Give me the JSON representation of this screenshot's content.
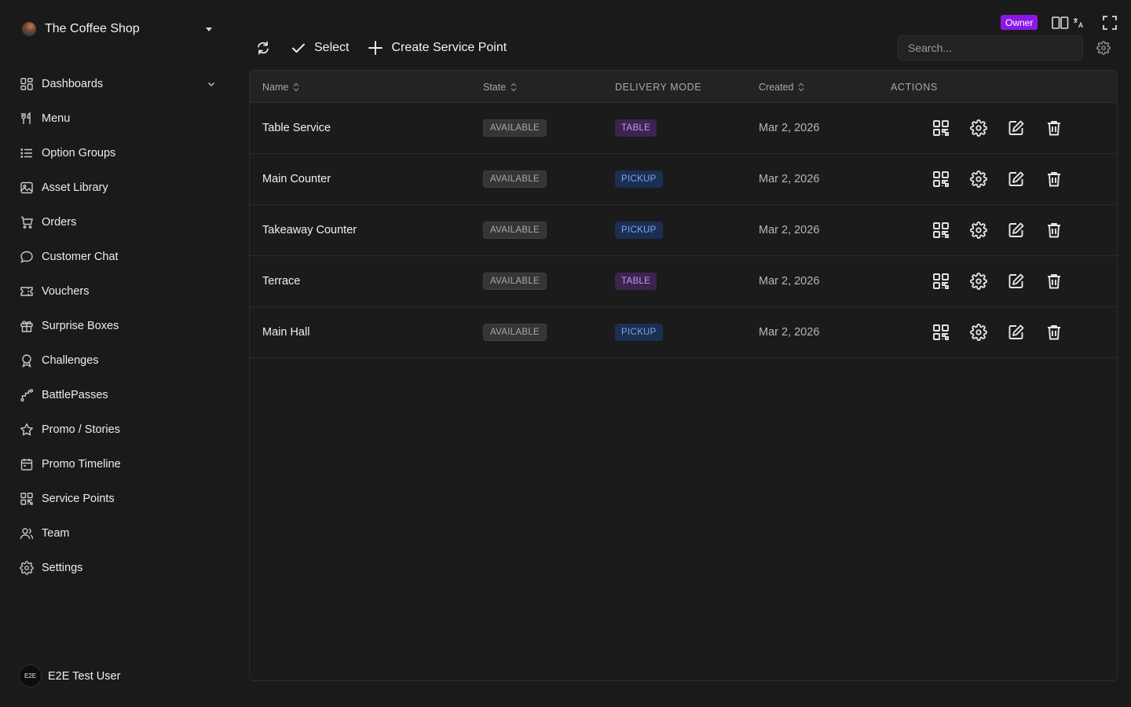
{
  "shop": {
    "name": "The Coffee Shop"
  },
  "nav": {
    "items": [
      {
        "label": "Dashboards",
        "icon": "dashboard-icon",
        "has_chevron": true
      },
      {
        "label": "Menu",
        "icon": "utensils-icon"
      },
      {
        "label": "Option Groups",
        "icon": "list-icon"
      },
      {
        "label": "Asset Library",
        "icon": "image-icon"
      },
      {
        "label": "Orders",
        "icon": "cart-icon"
      },
      {
        "label": "Customer Chat",
        "icon": "chat-icon"
      },
      {
        "label": "Vouchers",
        "icon": "ticket-icon"
      },
      {
        "label": "Surprise Boxes",
        "icon": "gift-icon"
      },
      {
        "label": "Challenges",
        "icon": "award-icon"
      },
      {
        "label": "BattlePasses",
        "icon": "route-icon"
      },
      {
        "label": "Promo / Stories",
        "icon": "star-icon"
      },
      {
        "label": "Promo Timeline",
        "icon": "calendar-icon"
      },
      {
        "label": "Service Points",
        "icon": "qr-grid-icon"
      },
      {
        "label": "Team",
        "icon": "users-icon"
      },
      {
        "label": "Settings",
        "icon": "gear-icon"
      }
    ]
  },
  "user": {
    "initials": "E2E",
    "name": "E2E Test User"
  },
  "header": {
    "role_badge": "Owner"
  },
  "toolbar": {
    "select_label": "Select",
    "create_label": "Create Service Point"
  },
  "search": {
    "placeholder": "Search..."
  },
  "table": {
    "columns": {
      "name": "Name",
      "state": "State",
      "delivery_mode": "DELIVERY MODE",
      "created": "Created",
      "actions": "ACTIONS"
    },
    "rows": [
      {
        "name": "Table Service",
        "state": "AVAILABLE",
        "mode": "TABLE",
        "created": "Mar 2, 2026"
      },
      {
        "name": "Main Counter",
        "state": "AVAILABLE",
        "mode": "PICKUP",
        "created": "Mar 2, 2026"
      },
      {
        "name": "Takeaway Counter",
        "state": "AVAILABLE",
        "mode": "PICKUP",
        "created": "Mar 2, 2026"
      },
      {
        "name": "Terrace",
        "state": "AVAILABLE",
        "mode": "TABLE",
        "created": "Mar 2, 2026"
      },
      {
        "name": "Main Hall",
        "state": "AVAILABLE",
        "mode": "PICKUP",
        "created": "Mar 2, 2026"
      }
    ]
  },
  "colors": {
    "background": "#1a1a1a",
    "owner_badge": "#8b18e6",
    "table_badge": "#c29ae6",
    "pickup_badge": "#79a6ee"
  }
}
